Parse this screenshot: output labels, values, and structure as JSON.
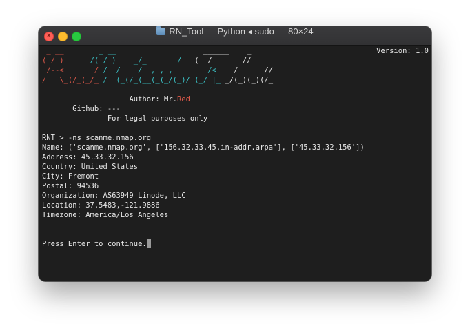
{
  "window": {
    "title": "RN_Tool — Python ◂ sudo — 80×24",
    "icon": "folder-icon",
    "close_glyph": "×"
  },
  "version": "Version: 1.0",
  "banner": [
    {
      "red": " _ __",
      "cyan": "        _ __",
      "white": "                    ______    _"
    },
    {
      "red": "( / )",
      "cyan": "      /( / )    _/_       /",
      "white": "   (  /       //"
    },
    {
      "red": " /--<  _  __/",
      "cyan": " /  / _  /  , , , __ _   /<",
      "white": "    /__ __ //"
    },
    {
      "red": "/   \\_(/_(_/_",
      "cyan": " /  (_(/_(__(_(_/(_)/ (_/ |_",
      "white": " _/(_)(_)(/_"
    }
  ],
  "credits": {
    "author_prefix": "Author: Mr.",
    "author_name": "Red",
    "github": "Github: ---",
    "legal": "For legal purposes only"
  },
  "output": {
    "command": "RNT > -ns scanme.nmap.org",
    "name": "Name: ('scanme.nmap.org', ['156.32.33.45.in-addr.arpa'], ['45.33.32.156'])",
    "address": "Address: 45.33.32.156",
    "country": "Country: United States",
    "city": "City: Fremont",
    "postal": "Postal: 94536",
    "organization": "Organization: AS63949 Linode, LLC",
    "location": "Location: 37.5483,-121.9886",
    "timezone": "Timezone: America/Los_Angeles"
  },
  "prompt": "Press Enter to continue.",
  "colors": {
    "red": "#e05a4a",
    "cyan": "#3cc4c8",
    "background": "#1e1e1e"
  }
}
